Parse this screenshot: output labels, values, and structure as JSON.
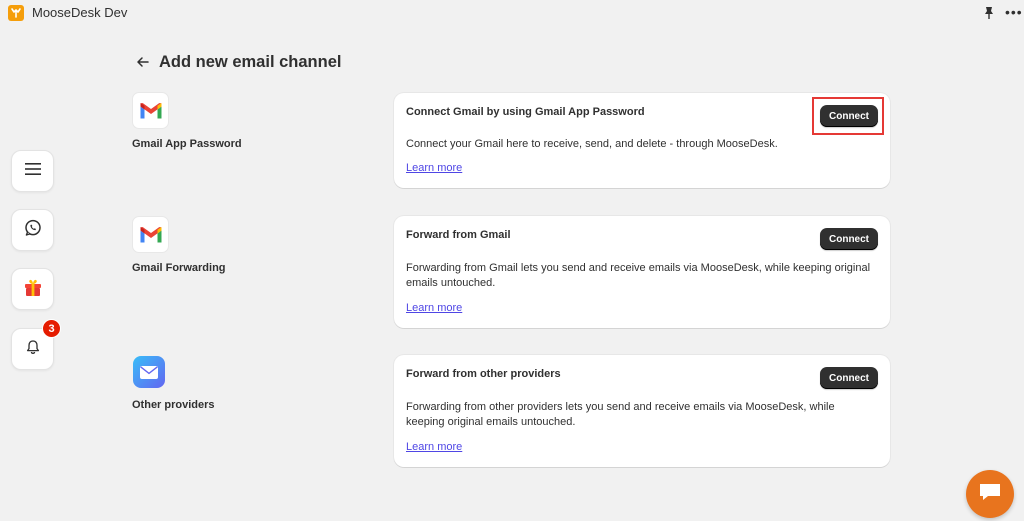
{
  "app": {
    "title": "MooseDesk Dev"
  },
  "colors": {
    "background": "#f1f1f1",
    "button": "#303030",
    "link": "#4f46e5",
    "badge": "#e51c00",
    "chat_fab": "#e8741e",
    "highlight": "#e53935"
  },
  "sidebar": {
    "items": [
      {
        "icon": "menu-icon"
      },
      {
        "icon": "whatsapp-icon"
      },
      {
        "icon": "gift-icon"
      },
      {
        "icon": "bell-icon",
        "badge": "3"
      }
    ]
  },
  "page": {
    "title": "Add new email channel"
  },
  "channels": [
    {
      "icon": "gmail-icon",
      "label": "Gmail App Password",
      "card_title": "Connect Gmail by using Gmail App Password",
      "description": "Connect your Gmail here to receive, send, and delete - through MooseDesk.",
      "link": "Learn more",
      "button": "Connect"
    },
    {
      "icon": "gmail-icon",
      "label": "Gmail Forwarding",
      "card_title": "Forward from Gmail",
      "description": "Forwarding from Gmail lets you send and receive emails via MooseDesk, while keeping original emails untouched.",
      "link": "Learn more",
      "button": "Connect"
    },
    {
      "icon": "mail-icon",
      "label": "Other providers",
      "card_title": "Forward from other providers",
      "description": "Forwarding from other providers lets you send and receive emails via MooseDesk, while keeping original emails untouched.",
      "link": "Learn more",
      "button": "Connect"
    }
  ]
}
